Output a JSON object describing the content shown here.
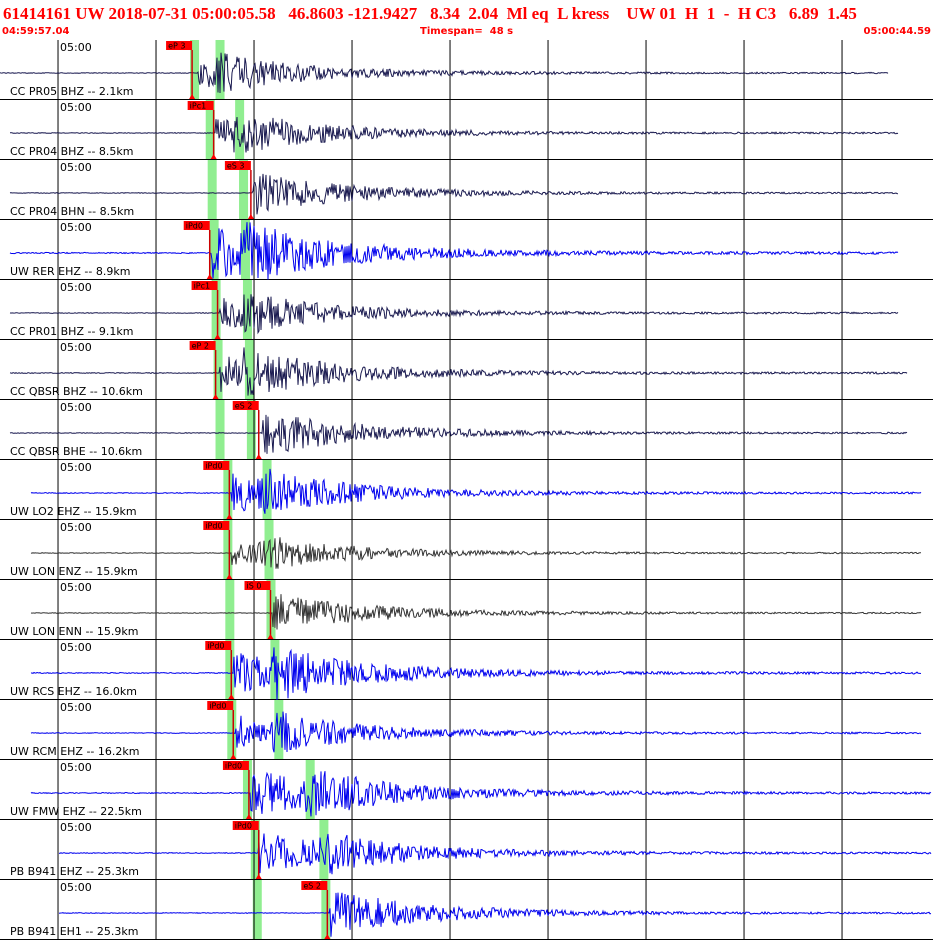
{
  "header": {
    "title_parts": [
      "61414161",
      "UW",
      "2018-07-31",
      "05:00:05.58",
      "46.8603",
      "-121.9427",
      "8.34",
      "2.04",
      "Ml",
      "eq",
      "L",
      "kress",
      "UW",
      "01",
      "H",
      "1",
      "-",
      "H",
      "C3",
      "6.89",
      "1.45"
    ],
    "start_time": "04:59:57.04",
    "timespan_label": "Timespan=",
    "timespan_value": "48 s",
    "end_time": "05:00:44.59"
  },
  "colors": {
    "header_text": "#ff0000",
    "pick_box": "#ff0000",
    "pick_line": "#cc0000",
    "window": "#90ee90",
    "trace_navy": "#1a1a50",
    "trace_blue": "#0000ee",
    "trace_gray": "#333333",
    "tick_line": "#000000"
  },
  "chart_data": {
    "type": "seismogram",
    "x_range_seconds": [
      0,
      47.55
    ],
    "tick_label": "05:00",
    "tick_time_seconds": 2.96,
    "tick_interval_seconds": 5,
    "traces": [
      {
        "label": "CC PR05 BHZ -- 2.1km",
        "pick": "eP 3",
        "pick_time": 9.8,
        "p_window": 9.9,
        "s_window": 11.2,
        "arrival": 10.1,
        "color": "navy",
        "amplitude": 0.55,
        "end_time": 45.3,
        "start_time": 0
      },
      {
        "label": "CC PR04 BHZ -- 8.5km",
        "pick": "iPc1",
        "pick_time": 10.9,
        "p_window": 10.7,
        "s_window": 12.2,
        "arrival": 11.0,
        "color": "navy",
        "amplitude": 0.6,
        "end_time": 45.8,
        "start_time": 0.5
      },
      {
        "label": "CC PR04 BHN -- 8.5km",
        "pick": "eS 3",
        "pick_time": 12.8,
        "p_window": 10.8,
        "s_window": 12.4,
        "arrival": 12.9,
        "color": "navy",
        "amplitude": 0.55,
        "end_time": 45.8,
        "start_time": 0.5
      },
      {
        "label": "UW RER EHZ -- 8.9km",
        "pick": "iPd0",
        "pick_time": 10.7,
        "p_window": 10.9,
        "s_window": 12.5,
        "arrival": 10.8,
        "color": "blue",
        "amplitude": 0.95,
        "end_time": 45.8,
        "start_time": 0.5
      },
      {
        "label": "CC PR01 BHZ -- 9.1km",
        "pick": "iPc1",
        "pick_time": 11.1,
        "p_window": 11.0,
        "s_window": 12.6,
        "arrival": 11.2,
        "color": "navy",
        "amplitude": 0.6,
        "end_time": 45.8,
        "start_time": 0.5
      },
      {
        "label": "CC QBSR BHZ -- 10.6km",
        "pick": "eP 2",
        "pick_time": 11.0,
        "p_window": 11.1,
        "s_window": 12.7,
        "arrival": 11.2,
        "color": "navy",
        "amplitude": 0.7,
        "end_time": 46.3,
        "start_time": 0.5
      },
      {
        "label": "CC QBSR BHE -- 10.6km",
        "pick": "eS 2",
        "pick_time": 13.2,
        "p_window": 11.2,
        "s_window": 12.8,
        "arrival": 13.4,
        "color": "navy",
        "amplitude": 0.6,
        "end_time": 46.3,
        "start_time": 0.5
      },
      {
        "label": "UW LO2 EHZ -- 15.9km",
        "pick": "iPd0",
        "pick_time": 11.7,
        "p_window": 11.6,
        "s_window": 13.6,
        "arrival": 11.8,
        "color": "blue",
        "amplitude": 0.7,
        "end_time": 47.0,
        "start_time": 1.6
      },
      {
        "label": "UW LON ENZ -- 15.9km",
        "pick": "iPd0",
        "pick_time": 11.7,
        "p_window": 11.6,
        "s_window": 13.7,
        "arrival": 11.8,
        "color": "gray",
        "amplitude": 0.5,
        "end_time": 47.0,
        "start_time": 1.6
      },
      {
        "label": "UW LON ENN -- 15.9km",
        "pick": "iS 0",
        "pick_time": 13.8,
        "p_window": 11.7,
        "s_window": 13.8,
        "arrival": 13.9,
        "color": "gray",
        "amplitude": 0.5,
        "end_time": 47.0,
        "start_time": 1.6
      },
      {
        "label": "UW RCS EHZ -- 16.0km",
        "pick": "iPd0",
        "pick_time": 11.8,
        "p_window": 11.7,
        "s_window": 14.0,
        "arrival": 11.9,
        "color": "blue",
        "amplitude": 0.85,
        "end_time": 47.0,
        "start_time": 1.6
      },
      {
        "label": "UW RCM EHZ -- 16.2km",
        "pick": "iPd0",
        "pick_time": 11.9,
        "p_window": 11.8,
        "s_window": 14.2,
        "arrival": 12.0,
        "color": "blue",
        "amplitude": 0.65,
        "end_time": 47.0,
        "start_time": 1.6
      },
      {
        "label": "UW FMW EHZ -- 22.5km",
        "pick": "iPd0",
        "pick_time": 12.7,
        "p_window": 12.6,
        "s_window": 15.8,
        "arrival": 12.8,
        "color": "blue",
        "amplitude": 0.85,
        "end_time": 47.5,
        "start_time": 1.6
      },
      {
        "label": "PB B941 EHZ -- 25.3km",
        "pick": "iPd0",
        "pick_time": 13.2,
        "p_window": 13.0,
        "s_window": 16.5,
        "arrival": 13.2,
        "color": "blue",
        "amplitude": 0.75,
        "end_time": 47.5,
        "start_time": 3.0
      },
      {
        "label": "PB B941 EH1 -- 25.3km",
        "pick": "eS 2",
        "pick_time": 16.7,
        "p_window": 13.1,
        "s_window": 16.6,
        "arrival": 16.8,
        "color": "blue",
        "amplitude": 0.6,
        "end_time": 47.5,
        "start_time": 3.0
      }
    ]
  }
}
